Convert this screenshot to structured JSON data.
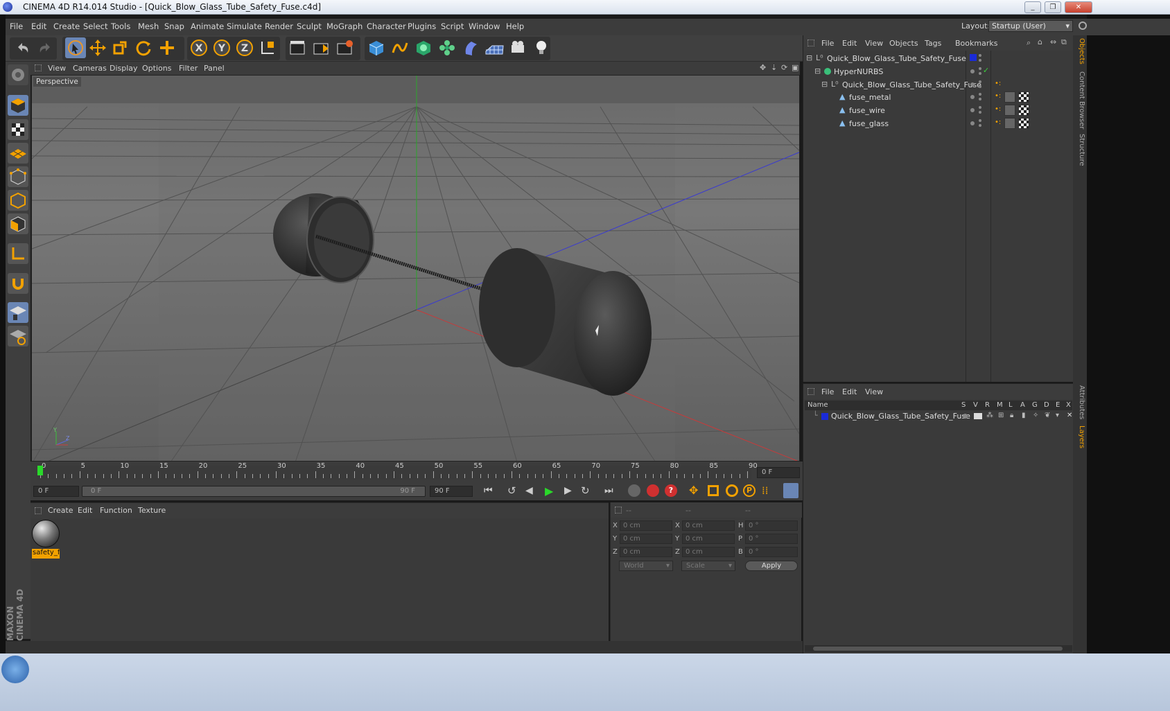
{
  "window": {
    "title": "CINEMA 4D R14.014 Studio - [Quick_Blow_Glass_Tube_Safety_Fuse.c4d]",
    "controls": [
      "_",
      "❐",
      "✕"
    ]
  },
  "menubar": {
    "items": [
      "File",
      "Edit",
      "Create",
      "Select",
      "Tools",
      "Mesh",
      "Snap",
      "Animate",
      "Simulate",
      "Render",
      "Sculpt",
      "MoGraph",
      "Character",
      "Plugins",
      "Script",
      "Window",
      "Help"
    ],
    "layout_label": "Layout:",
    "layout_value": "Startup (User)"
  },
  "toolbar": {
    "axis_labels": [
      "X",
      "Y",
      "Z"
    ]
  },
  "viewport": {
    "menu": [
      "View",
      "Cameras",
      "Display",
      "Options",
      "Filter",
      "Panel"
    ],
    "label": "Perspective",
    "axis_gizmo": {
      "y": "Y",
      "z": "Z"
    }
  },
  "timeline": {
    "ticks": [
      "0",
      "5",
      "10",
      "15",
      "20",
      "25",
      "30",
      "35",
      "40",
      "45",
      "50",
      "55",
      "60",
      "65",
      "70",
      "75",
      "80",
      "85",
      "90"
    ],
    "end_field": "0 F",
    "current_frame": "0 F",
    "range_start": "0 F",
    "range_end": "90 F",
    "max_frame": "90 F"
  },
  "materials": {
    "menu": [
      "Create",
      "Edit",
      "Function",
      "Texture"
    ],
    "items": [
      {
        "name": "safety_fi"
      }
    ]
  },
  "coordinates": {
    "headers": [
      "--",
      "--",
      "--"
    ],
    "rows": [
      {
        "l1": "X",
        "v1": "0 cm",
        "l2": "X",
        "v2": "0 cm",
        "l3": "H",
        "v3": "0 °"
      },
      {
        "l1": "Y",
        "v1": "0 cm",
        "l2": "Y",
        "v2": "0 cm",
        "l3": "P",
        "v3": "0 °"
      },
      {
        "l1": "Z",
        "v1": "0 cm",
        "l2": "Z",
        "v2": "0 cm",
        "l3": "B",
        "v3": "0 °"
      }
    ],
    "world": "World",
    "scale": "Scale",
    "apply": "Apply"
  },
  "objects": {
    "menu": [
      "File",
      "Edit",
      "View",
      "Objects",
      "Tags",
      "Bookmarks"
    ],
    "tree": [
      {
        "name": "Quick_Blow_Glass_Tube_Safety_Fuse",
        "indent": 0
      },
      {
        "name": "HyperNURBS",
        "indent": 1
      },
      {
        "name": "Quick_Blow_Glass_Tube_Safety_Fuse",
        "indent": 2
      },
      {
        "name": "fuse_metal",
        "indent": 3
      },
      {
        "name": "fuse_wire",
        "indent": 3
      },
      {
        "name": "fuse_glass",
        "indent": 3
      }
    ]
  },
  "layers": {
    "menu": [
      "File",
      "Edit",
      "View"
    ],
    "columns": [
      "Name",
      "S",
      "V",
      "R",
      "M",
      "L",
      "A",
      "G",
      "D",
      "E",
      "X"
    ],
    "rows": [
      {
        "name": "Quick_Blow_Glass_Tube_Safety_Fuse"
      }
    ]
  },
  "side_tabs": [
    "Objects",
    "Content Browser",
    "Structure",
    "Attributes",
    "Layers"
  ],
  "brand": "MAXON CINEMA 4D",
  "colors": {
    "accent": "#f2a100",
    "selection": "#6a86b5",
    "layer_color": "#1a2bd8"
  }
}
